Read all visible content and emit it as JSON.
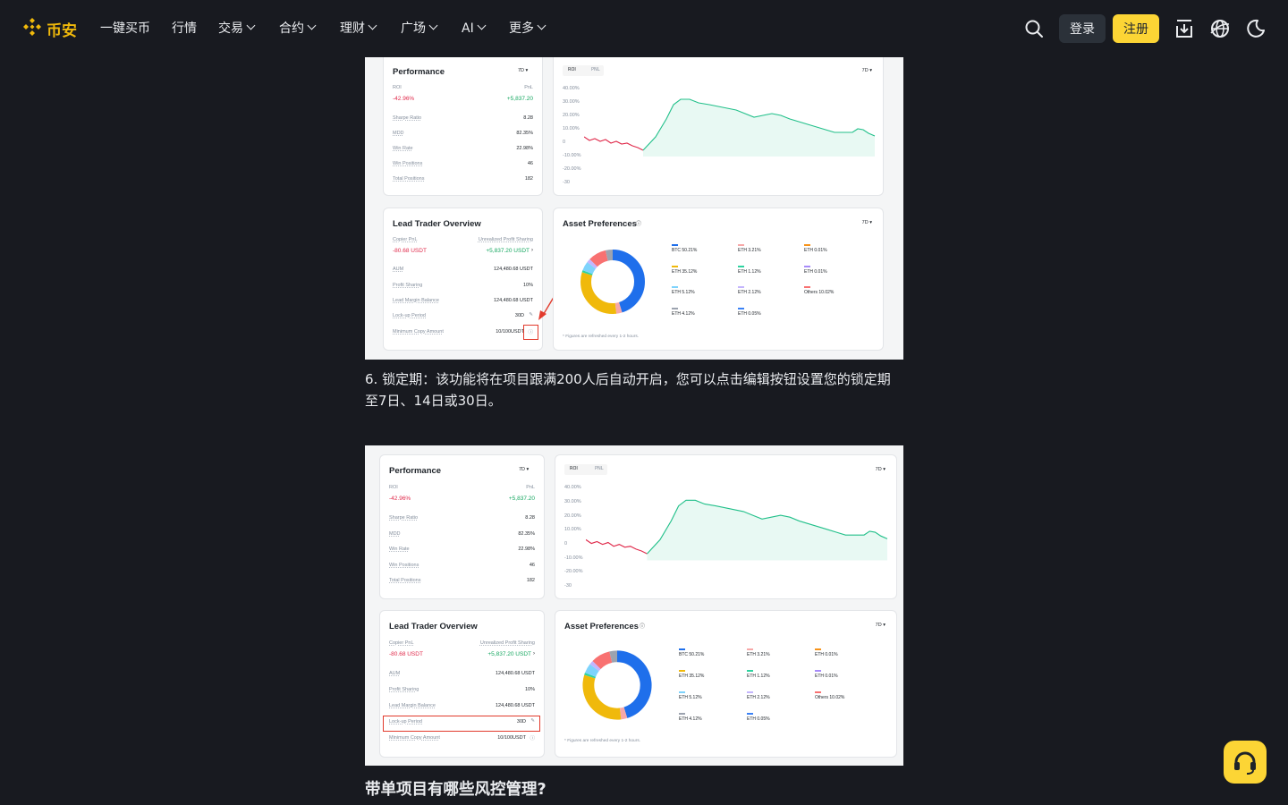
{
  "nav": {
    "logo_text": "币安",
    "items": [
      {
        "label": "一键买币",
        "dropdown": false
      },
      {
        "label": "行情",
        "dropdown": false
      },
      {
        "label": "交易",
        "dropdown": true
      },
      {
        "label": "合约",
        "dropdown": true
      },
      {
        "label": "理财",
        "dropdown": true
      },
      {
        "label": "广场",
        "dropdown": true
      },
      {
        "label": "AI",
        "dropdown": true
      },
      {
        "label": "更多",
        "dropdown": true
      }
    ],
    "login_label": "登录",
    "register_label": "注册",
    "brand_color": "#f0b90b",
    "register_color": "#fcd535"
  },
  "screenshots": [
    {
      "performance": {
        "title": "Performance",
        "period": "7D ▾",
        "roi_label": "ROI",
        "roi_value": "-42.96%",
        "pnl_label": "PnL",
        "pnl_value": "+5,837.20",
        "stats": [
          {
            "label": "Sharpe Ratio",
            "value": "8.28"
          },
          {
            "label": "MDD",
            "value": "82.35%"
          },
          {
            "label": "Win Rate",
            "value": "22.98%"
          },
          {
            "label": "Win Positions",
            "value": "46"
          },
          {
            "label": "Total Positions",
            "value": "182"
          }
        ]
      },
      "roi_chart": {
        "tab_active": "ROI",
        "tab_other": "PNL",
        "period": "7D ▾",
        "y_ticks": [
          "40.00%",
          "30.00%",
          "20.00%",
          "10.00%",
          "0",
          "-10.00%",
          "-20.00%",
          "-30"
        ]
      },
      "overview": {
        "title": "Lead Trader Overview",
        "copier_pnl_label": "Copier PnL",
        "copier_pnl_value": "-80.68 USDT",
        "unrealized_label": "Unrealized Profit Sharing",
        "unrealized_value": "+5,837.20 USDT",
        "rows": [
          {
            "label": "AUM",
            "value": "124,480.68 USDT"
          },
          {
            "label": "Profit Sharing",
            "value": "10%"
          },
          {
            "label": "Lead Margin Balance",
            "value": "124,480.68 USDT"
          },
          {
            "label": "Lock-up Period",
            "value": "30D"
          },
          {
            "label": "Minimum Copy Amount",
            "value": "10/100USDT"
          }
        ]
      },
      "assets": {
        "title": "Asset Preferences",
        "info_icon": "info-icon",
        "period": "7D ▾",
        "legend": [
          {
            "label": "BTC 50.21%",
            "color": "#1f6feb"
          },
          {
            "label": "ETH 3.21%",
            "color": "#f7a8a8"
          },
          {
            "label": "ETH 0.01%",
            "color": "#f7931a"
          },
          {
            "label": "ETH 35.12%",
            "color": "#f0b90b"
          },
          {
            "label": "ETH 1.12%",
            "color": "#2ed3a0"
          },
          {
            "label": "ETH 0.01%",
            "color": "#a78bfa"
          },
          {
            "label": "ETH 5.12%",
            "color": "#7dd3fc"
          },
          {
            "label": "ETH 2.12%",
            "color": "#c4b5fd"
          },
          {
            "label": "Others 10.02%",
            "color": "#f87171"
          },
          {
            "label": "ETH 4.12%",
            "color": "#9ca3af"
          },
          {
            "label": "ETH 0.05%",
            "color": "#3b82f6"
          }
        ],
        "footnote": "* Figures are refreshed every 1-2 hours."
      }
    }
  ],
  "paragraph": "6. 锁定期：该功能将在项目跟满200人后自动开启，您可以点击编辑按钮设置您的锁定期至7日、14日或30日。",
  "heading": "带单项目有哪些风控管理?",
  "support_icon": "headset-icon"
}
